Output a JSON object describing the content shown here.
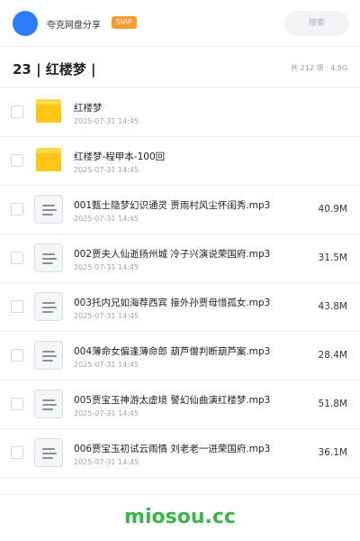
{
  "header": {
    "app_name": "夸克网盘分享",
    "badge": "SVIP",
    "search_placeholder": "搜索",
    "avatar_color": "#2b7cff"
  },
  "folder": {
    "title": "23 | 红楼梦 |",
    "summary": "共 212 项 · 4.5G"
  },
  "items": [
    {
      "type": "folder",
      "icon": "folder-icon",
      "name": "红楼梦",
      "date": "2025-07-31 14:45",
      "size": ""
    },
    {
      "type": "folder",
      "icon": "folder-icon",
      "name": "红楼梦-程甲本-100回",
      "date": "2025-07-31 14:45",
      "size": ""
    },
    {
      "type": "audio",
      "icon": "audio-file-icon",
      "name": "001甄士隐梦幻识通灵 贾雨村风尘怀闺秀.mp3",
      "date": "2025-07-31 14:45",
      "size": "40.9M"
    },
    {
      "type": "audio",
      "icon": "audio-file-icon",
      "name": "002贾夫人仙逝扬州城 冷子兴演说荣国府.mp3",
      "date": "2025-07-31 14:45",
      "size": "31.5M"
    },
    {
      "type": "audio",
      "icon": "audio-file-icon",
      "name": "003托内兄如海荐西宾 接外孙贾母惜孤女.mp3",
      "date": "2025-07-31 14:45",
      "size": "43.8M"
    },
    {
      "type": "audio",
      "icon": "audio-file-icon",
      "name": "004薄命女偏逢薄命郎 葫芦僧判断葫芦案.mp3",
      "date": "2025-07-31 14:45",
      "size": "28.4M"
    },
    {
      "type": "audio",
      "icon": "audio-file-icon",
      "name": "005贾宝玉神游太虚境 警幻仙曲演红楼梦.mp3",
      "date": "2025-07-31 14:45",
      "size": "51.8M"
    },
    {
      "type": "audio",
      "icon": "audio-file-icon",
      "name": "006贾宝玉初试云雨情 刘老老一进荣国府.mp3",
      "date": "2025-07-31 14:45",
      "size": "36.1M"
    }
  ],
  "footer": {
    "watermark": "miosou.cc",
    "watermark_color": "#3cb549"
  },
  "colors": {
    "folder_yellow": "#ffc517",
    "badge_orange": "#ff9a2e"
  }
}
